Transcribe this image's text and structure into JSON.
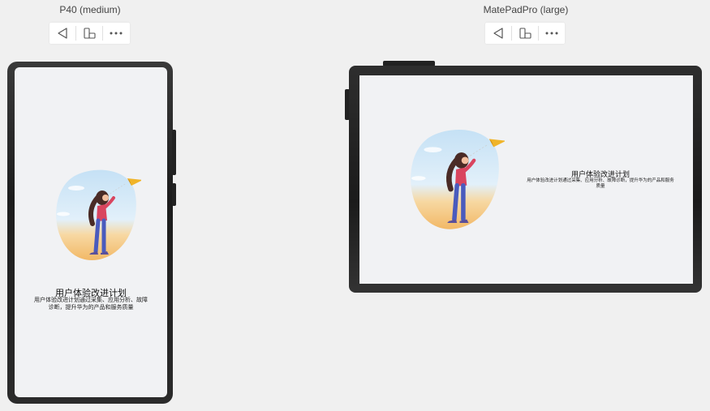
{
  "devices": [
    {
      "title": "P40 (medium)",
      "screen": {
        "headline": "用户体验改进计划",
        "body": "用户体验改进计划通过采集、应用分析、故障诊断，提升华为的产品和服务质量"
      }
    },
    {
      "title": "MatePadPro (large)",
      "screen": {
        "headline": "用户体验改进计划",
        "body": "用户体验改进计划通过采集、应用分析、故障诊断，提升华为的产品和服务质量"
      }
    }
  ],
  "toolbar_icons": [
    "back-triangle-icon",
    "rotate-device-icon",
    "more-dots-icon"
  ],
  "colors": {
    "background": "#f0f0f0",
    "screen": "#f1f2f4",
    "bezel": "#1c1c1c",
    "sky": "#cfe6f7",
    "sand": "#f2b866",
    "plane": "#f0b429",
    "jacket": "#d9455f",
    "jeans": "#4a5bbd"
  }
}
